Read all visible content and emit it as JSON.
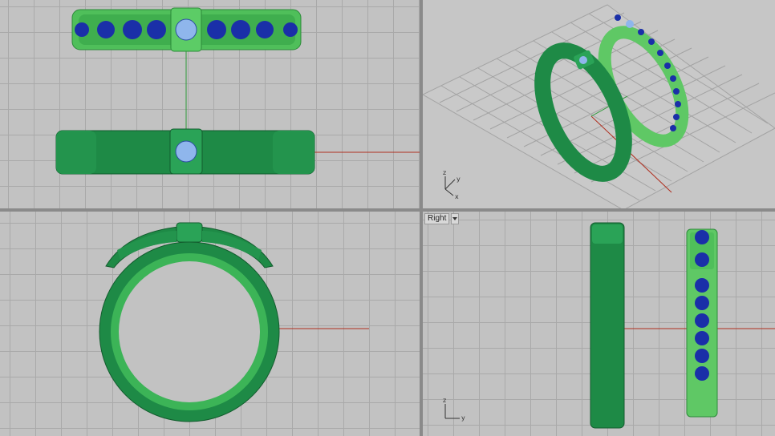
{
  "viewports": [
    {
      "id": "top",
      "label": "",
      "axes": {
        "x": "",
        "y": ""
      }
    },
    {
      "id": "perspective",
      "label": "",
      "axes": {
        "x": "x",
        "y": "y",
        "z": "z"
      }
    },
    {
      "id": "front",
      "label": "",
      "axes": {
        "x": "",
        "z": ""
      }
    },
    {
      "id": "right",
      "label": "Right",
      "axes": {
        "y": "y",
        "z": "z"
      }
    }
  ],
  "colors": {
    "grid_background": "#c2c2c2",
    "grid_line": "#a9a9a9",
    "x_axis": "#b03020",
    "y_axis": "#2f9a3a",
    "ring_dark_green": "#1e8a46",
    "ring_light_green": "#5fc865",
    "gem_blue": "#1a2fa8",
    "center_gem": "#8fb6ec"
  },
  "icons": {
    "viewport_menu": "dropdown-arrow-icon"
  }
}
